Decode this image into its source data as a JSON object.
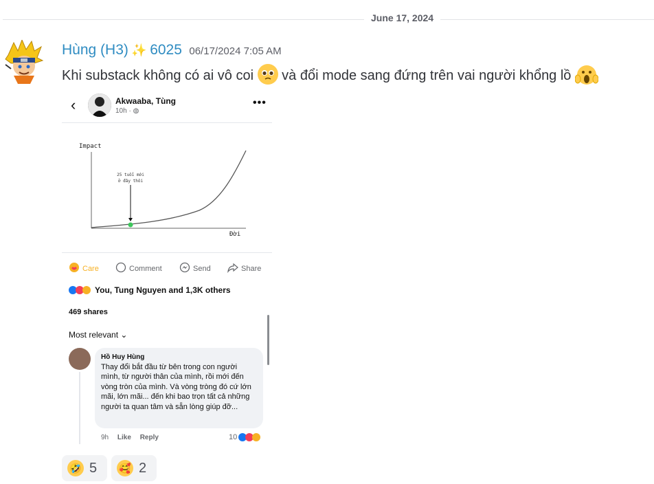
{
  "divider": {
    "date": "June 17, 2024"
  },
  "message": {
    "username": "Hùng (H3)",
    "sparkle_icon": "sparkles-icon",
    "badge": "6025",
    "timestamp": "06/17/2024 7:05 AM",
    "text_part1": "Khi substack không có ai vô coi",
    "text_part2": "và đổi mode sang đứng trên vai người khổng lồ"
  },
  "post": {
    "author": "Akwaaba, Tùng",
    "time": "10h ·",
    "more": "•••",
    "chart_data": {
      "type": "line",
      "ylabel": "Impact",
      "xlabel": "Đời",
      "annotation_line1": "25 tuổi mới",
      "annotation_line2": "ở đây thôi",
      "marker_color": "#3ec65c"
    },
    "actions": [
      {
        "label": "Care",
        "icon": "care-icon",
        "color": "#f7b125"
      },
      {
        "label": "Comment",
        "icon": "comment-icon",
        "color": "#65676b"
      },
      {
        "label": "Send",
        "icon": "messenger-icon",
        "color": "#65676b"
      },
      {
        "label": "Share",
        "icon": "share-icon",
        "color": "#65676b"
      }
    ],
    "reactions_text": "You, Tung Nguyen and 1,3K others",
    "shares": "469 shares",
    "sort": "Most relevant",
    "comment": {
      "name": "Hồ Huy Hùng",
      "text": "Thay đổi bắt đầu từ bên trong con người mình, từ người thân của mình, rồi mới đến vòng tròn của mình. Và vòng tròng đó cứ lớn mãi, lớn mãi... đến khi bao trọn tất cả những người ta quan tâm và sẵn lòng giúp đỡ...",
      "time": "9h",
      "like": "Like",
      "reply": "Reply",
      "count": "10"
    }
  },
  "reactions": [
    {
      "emoji": "🤣",
      "icon": "rolling-laughing-icon",
      "count": "5"
    },
    {
      "emoji": "🥰",
      "icon": "smiling-hearts-icon",
      "count": "2"
    }
  ]
}
